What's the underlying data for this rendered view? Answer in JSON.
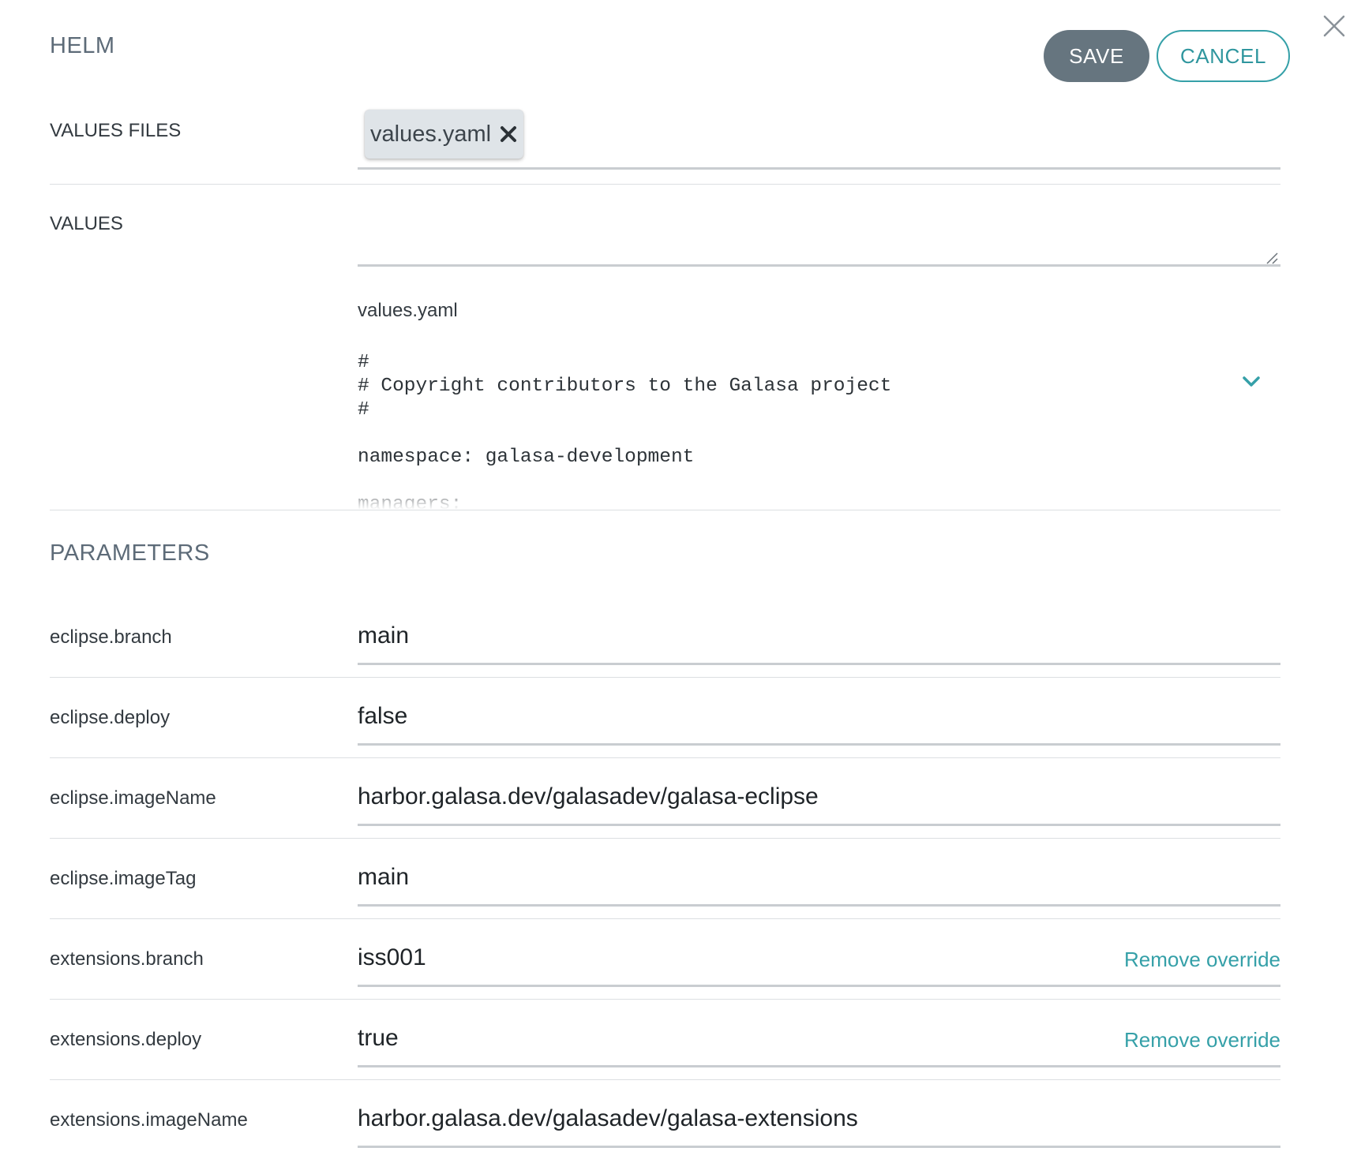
{
  "header": {
    "title": "HELM",
    "save_label": "SAVE",
    "cancel_label": "CANCEL"
  },
  "values_files": {
    "label": "VALUES FILES",
    "chips": [
      "values.yaml"
    ]
  },
  "values": {
    "label": "VALUES",
    "textarea_value": "",
    "preview": {
      "filename": "values.yaml",
      "code": "#\n# Copyright contributors to the Galasa project\n#\n\nnamespace: galasa-development\n\nmanagers:"
    }
  },
  "parameters": {
    "title": "PARAMETERS",
    "remove_override_label": "Remove override",
    "rows": [
      {
        "label": "eclipse.branch",
        "value": "main",
        "override": false
      },
      {
        "label": "eclipse.deploy",
        "value": "false",
        "override": false
      },
      {
        "label": "eclipse.imageName",
        "value": "harbor.galasa.dev/galasadev/galasa-eclipse",
        "override": false
      },
      {
        "label": "eclipse.imageTag",
        "value": "main",
        "override": false
      },
      {
        "label": "extensions.branch",
        "value": "iss001",
        "override": true
      },
      {
        "label": "extensions.deploy",
        "value": "true",
        "override": true
      },
      {
        "label": "extensions.imageName",
        "value": "harbor.galasa.dev/galasadev/galasa-extensions",
        "override": false
      }
    ]
  },
  "colors": {
    "accent": "#35a0a8",
    "save_bg": "#66757f",
    "section_title": "#5d6b78",
    "divider": "#dcdfe2",
    "underline": "#c9cdd1"
  },
  "icons": {
    "close": "close-icon",
    "chip_remove": "chip-remove-icon",
    "expand": "chevron-down-icon",
    "resize": "resize-grip-icon"
  }
}
